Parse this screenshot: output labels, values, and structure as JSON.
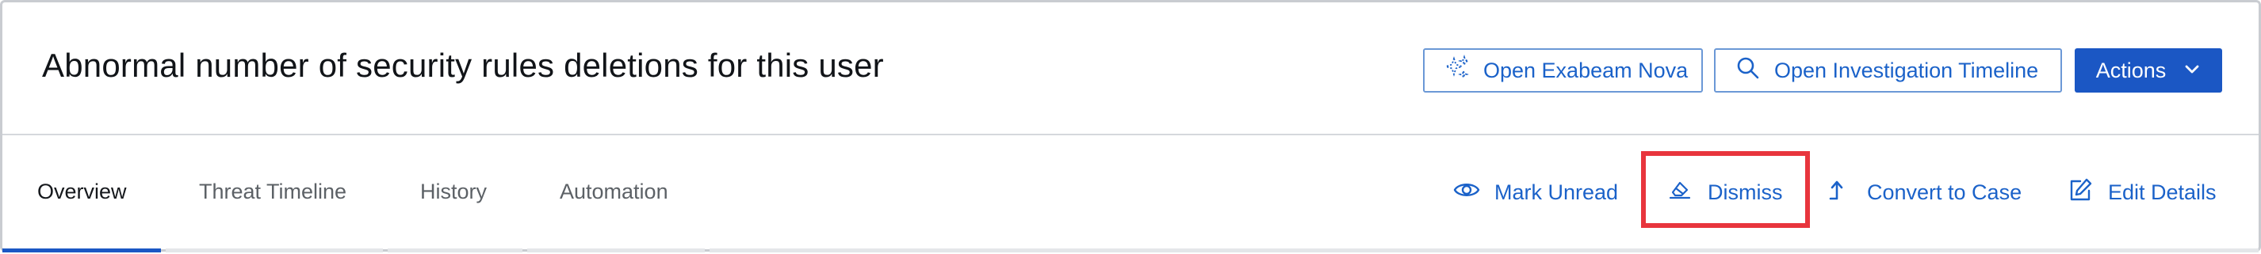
{
  "header": {
    "title": "Abnormal number of security rules deletions for this user",
    "buttons": {
      "nova_label": "Open Exabeam Nova",
      "nova_icon": "sparkle-icon",
      "timeline_label": "Open Investigation Timeline",
      "timeline_icon": "search-icon",
      "actions_label": "Actions",
      "actions_icon": "chevron-down-icon"
    }
  },
  "tabs": [
    {
      "label": "Overview",
      "active": true
    },
    {
      "label": "Threat Timeline",
      "active": false
    },
    {
      "label": "History",
      "active": false
    },
    {
      "label": "Automation",
      "active": false
    }
  ],
  "actions": [
    {
      "label": "Mark Unread",
      "icon": "eye-icon"
    },
    {
      "label": "Dismiss",
      "icon": "eraser-icon"
    },
    {
      "label": "Convert to Case",
      "icon": "arrow-up-turn-icon"
    },
    {
      "label": "Edit Details",
      "icon": "edit-icon"
    }
  ],
  "colors": {
    "accent": "#1b57c4",
    "link": "#1b62c9",
    "highlight": "#e8353d"
  }
}
